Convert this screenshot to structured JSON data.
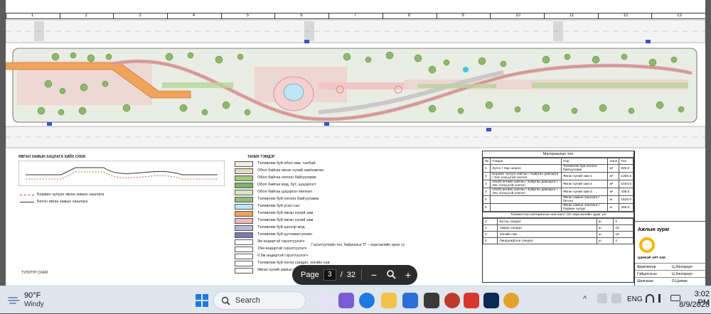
{
  "ruler": {
    "numbers": [
      "1",
      "2",
      "3",
      "4",
      "5",
      "6",
      "7",
      "8",
      "9",
      "10",
      "11",
      "12",
      "13"
    ]
  },
  "plan_sheet": {
    "section_title": "ЯВГАН ЗАМЫН ХАЦЛАГА ХИЙХ СХЕМ",
    "scheme_legend": [
      {
        "label": "Боржин чулуун явган замын хашлага",
        "color": "#c0392b"
      },
      {
        "label": "Бетон явган замын хашлага",
        "color": "#333333"
      }
    ],
    "bottom_left_title": "ТУЛХҮҮР СХЕМ",
    "legend_title": "ТАНИХ ТЭМДЭГ",
    "legend_items": [
      {
        "label": "Төлөвлөж буй обол зам, талбай",
        "color": "#f2ece4"
      },
      {
        "label": "Обол байгаа явган хүний зам/хавтан",
        "color": "#e8d9c0"
      },
      {
        "label": "Обол байгаа ногоон байгууламж",
        "color": "#a7c97a"
      },
      {
        "label": "Обол байгаа мод, бут, цэцэрлэгт",
        "color": "#7fb26a"
      },
      {
        "label": "Обол байгаа цэцэрлэг мөнхөл",
        "color": "#d8e6c4"
      },
      {
        "label": "Төлөвлөж буй ногоон байгууламж",
        "color": "#8dc07a"
      },
      {
        "label": "Төлөвлөж буй усан сан",
        "color": "#bfe6f5"
      },
      {
        "label": "Төлөвлөж буй явган хүний зам",
        "color": "#f0a35a"
      },
      {
        "label": "Төлөвлөж буй явган хүний зам",
        "color": "#f2b8b8"
      },
      {
        "label": "Төлөвлөж буй цэнхэр мод",
        "color": "#b8b8d8"
      },
      {
        "label": "Төлөвлөж буй цутгамал резин",
        "color": "#7a7ab8"
      },
      {
        "label": "3м өндөртэй гэрэлтүүлэгч",
        "color": "#ffffff"
      },
      {
        "label": "15м өндөртэй гэрэлтүүлэгч",
        "color": "#ffffff"
      },
      {
        "label": "0.5м өндөртэй гэрэлтүүлэгч",
        "color": "#ffffff"
      },
      {
        "label": "Төлөвлөж буй онгон сандал, хогийн сав",
        "color": "#ffffff"
      },
      {
        "label": "Явган хүний замын гарц",
        "color": "#ffffff"
      }
    ],
    "legend_note": "Гэрэлтүүлгийн тоо, байрлалыг ТГ – мэргэжлийн зураг үз",
    "materials": {
      "title": "Материалын тоо",
      "headers": [
        "№",
        "Тэмдэг",
        "Нэр",
        "Нэгж",
        "Тоо"
      ],
      "rows": [
        {
          "n": "1",
          "name": "Төлөвлөж буй ногоон байгууламж",
          "detail": "Зүлэг / Хар шороо",
          "unit": "м²",
          "qty": "826.0"
        },
        {
          "n": "2",
          "name": "Явган хүний зам-1",
          "detail": "Боржин чулуун хавтан / Хайрган давхарга / Элс хольцтой хонгил",
          "unit": "м²",
          "qty": "1355.6"
        },
        {
          "n": "3",
          "name": "Явган хүний зам-2",
          "detail": "10х20 өнгийн хавтан / Хайрган давхарга / Элс хольцтой хонгил",
          "unit": "м²",
          "qty": "1034.0"
        },
        {
          "n": "4",
          "name": "Явган хүний зам-3",
          "detail": "10х20 өнгийн хавтан / Хайрган давхарга / Элс хольцтой хонгил",
          "unit": "м²",
          "qty": "438.5"
        },
        {
          "n": "5",
          "name": "Явган замын хашлага /бетон/",
          "detail": "",
          "unit": "м",
          "qty": "1625.0"
        },
        {
          "n": "6",
          "name": "Явган замын хашлага /боржин чулуу/",
          "detail": "",
          "unit": "м",
          "qty": "405.0"
        }
      ],
      "subtitle": "Тохижилтын материалын жагсаалт /ЗА мэргэжлийн зураг үз/",
      "items": [
        {
          "n": "1",
          "name": "Бүтэц сандал",
          "unit": "ш",
          "qty": "5"
        },
        {
          "n": "2",
          "name": "Амрах сандал",
          "unit": "ш",
          "qty": "19"
        },
        {
          "n": "3",
          "name": "Хогийн сав",
          "unit": "ш",
          "qty": "19"
        },
        {
          "n": "4",
          "name": "Ландшафтын сандал",
          "unit": "ш",
          "qty": "4"
        }
      ]
    },
    "title_block": {
      "sheet_name": "Ажлын зураг",
      "company": "ЦЭНХЭР АРТ ХХК",
      "roles": [
        {
          "role": "Архитектор",
          "name": "Ц.Хонгорзул"
        },
        {
          "role": "Гүйцэтгэсэн",
          "name": "Ц.Хонгорзул"
        },
        {
          "role": "Шалгасан",
          "name": "О.Цэлмэг"
        }
      ]
    }
  },
  "toolbar": {
    "page_label": "Page",
    "page_value": "3",
    "separator": "/",
    "page_total": "32",
    "zoom_out": "−",
    "zoom_in": "+"
  },
  "taskbar": {
    "weather_temp": "90°F",
    "weather_desc": "Windy",
    "search_placeholder": "Search",
    "language": "ENG",
    "time": "3:02 PM",
    "date": "8/9/2023"
  }
}
